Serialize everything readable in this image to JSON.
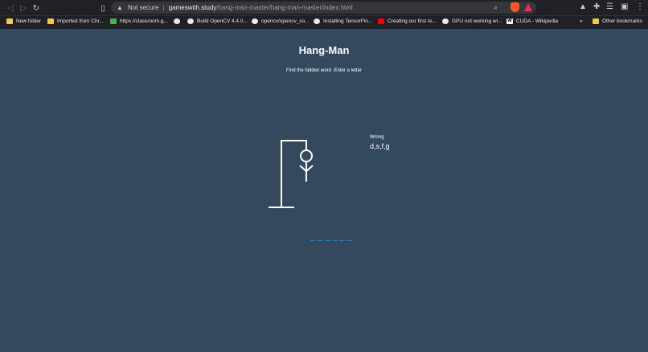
{
  "browser": {
    "security_label": "Not secure",
    "url_host": "gameswith.study",
    "url_path": "/hang-man-master/hang-man-master/index.html"
  },
  "bookmarks": [
    {
      "label": "New folder",
      "icon": "folder-icon"
    },
    {
      "label": "Imported from Chr...",
      "icon": "folder-icon"
    },
    {
      "label": "https://classroom.g...",
      "icon": "classroom-icon"
    },
    {
      "label": "",
      "icon": "globe-icon"
    },
    {
      "label": "Build OpenCV 4.4.0...",
      "icon": "site-icon"
    },
    {
      "label": "opencv/opencv_co...",
      "icon": "github-icon"
    },
    {
      "label": "Installing TensorFlo...",
      "icon": "site-icon"
    },
    {
      "label": "Creating our first re...",
      "icon": "youtube-icon"
    },
    {
      "label": "GPU not working wi...",
      "icon": "github-icon"
    },
    {
      "label": "CUDA - Wikipedia",
      "icon": "wikipedia-icon"
    },
    {
      "label": "»",
      "icon": ""
    },
    {
      "label": "Other bookmarks",
      "icon": "folder-icon"
    }
  ],
  "game": {
    "title": "Hang-Man",
    "instructions": "Find the hidden word -Enter a letter",
    "wrong_label": "Wrong",
    "wrong_letters": "d,s,f,g",
    "blank_count": 6
  }
}
